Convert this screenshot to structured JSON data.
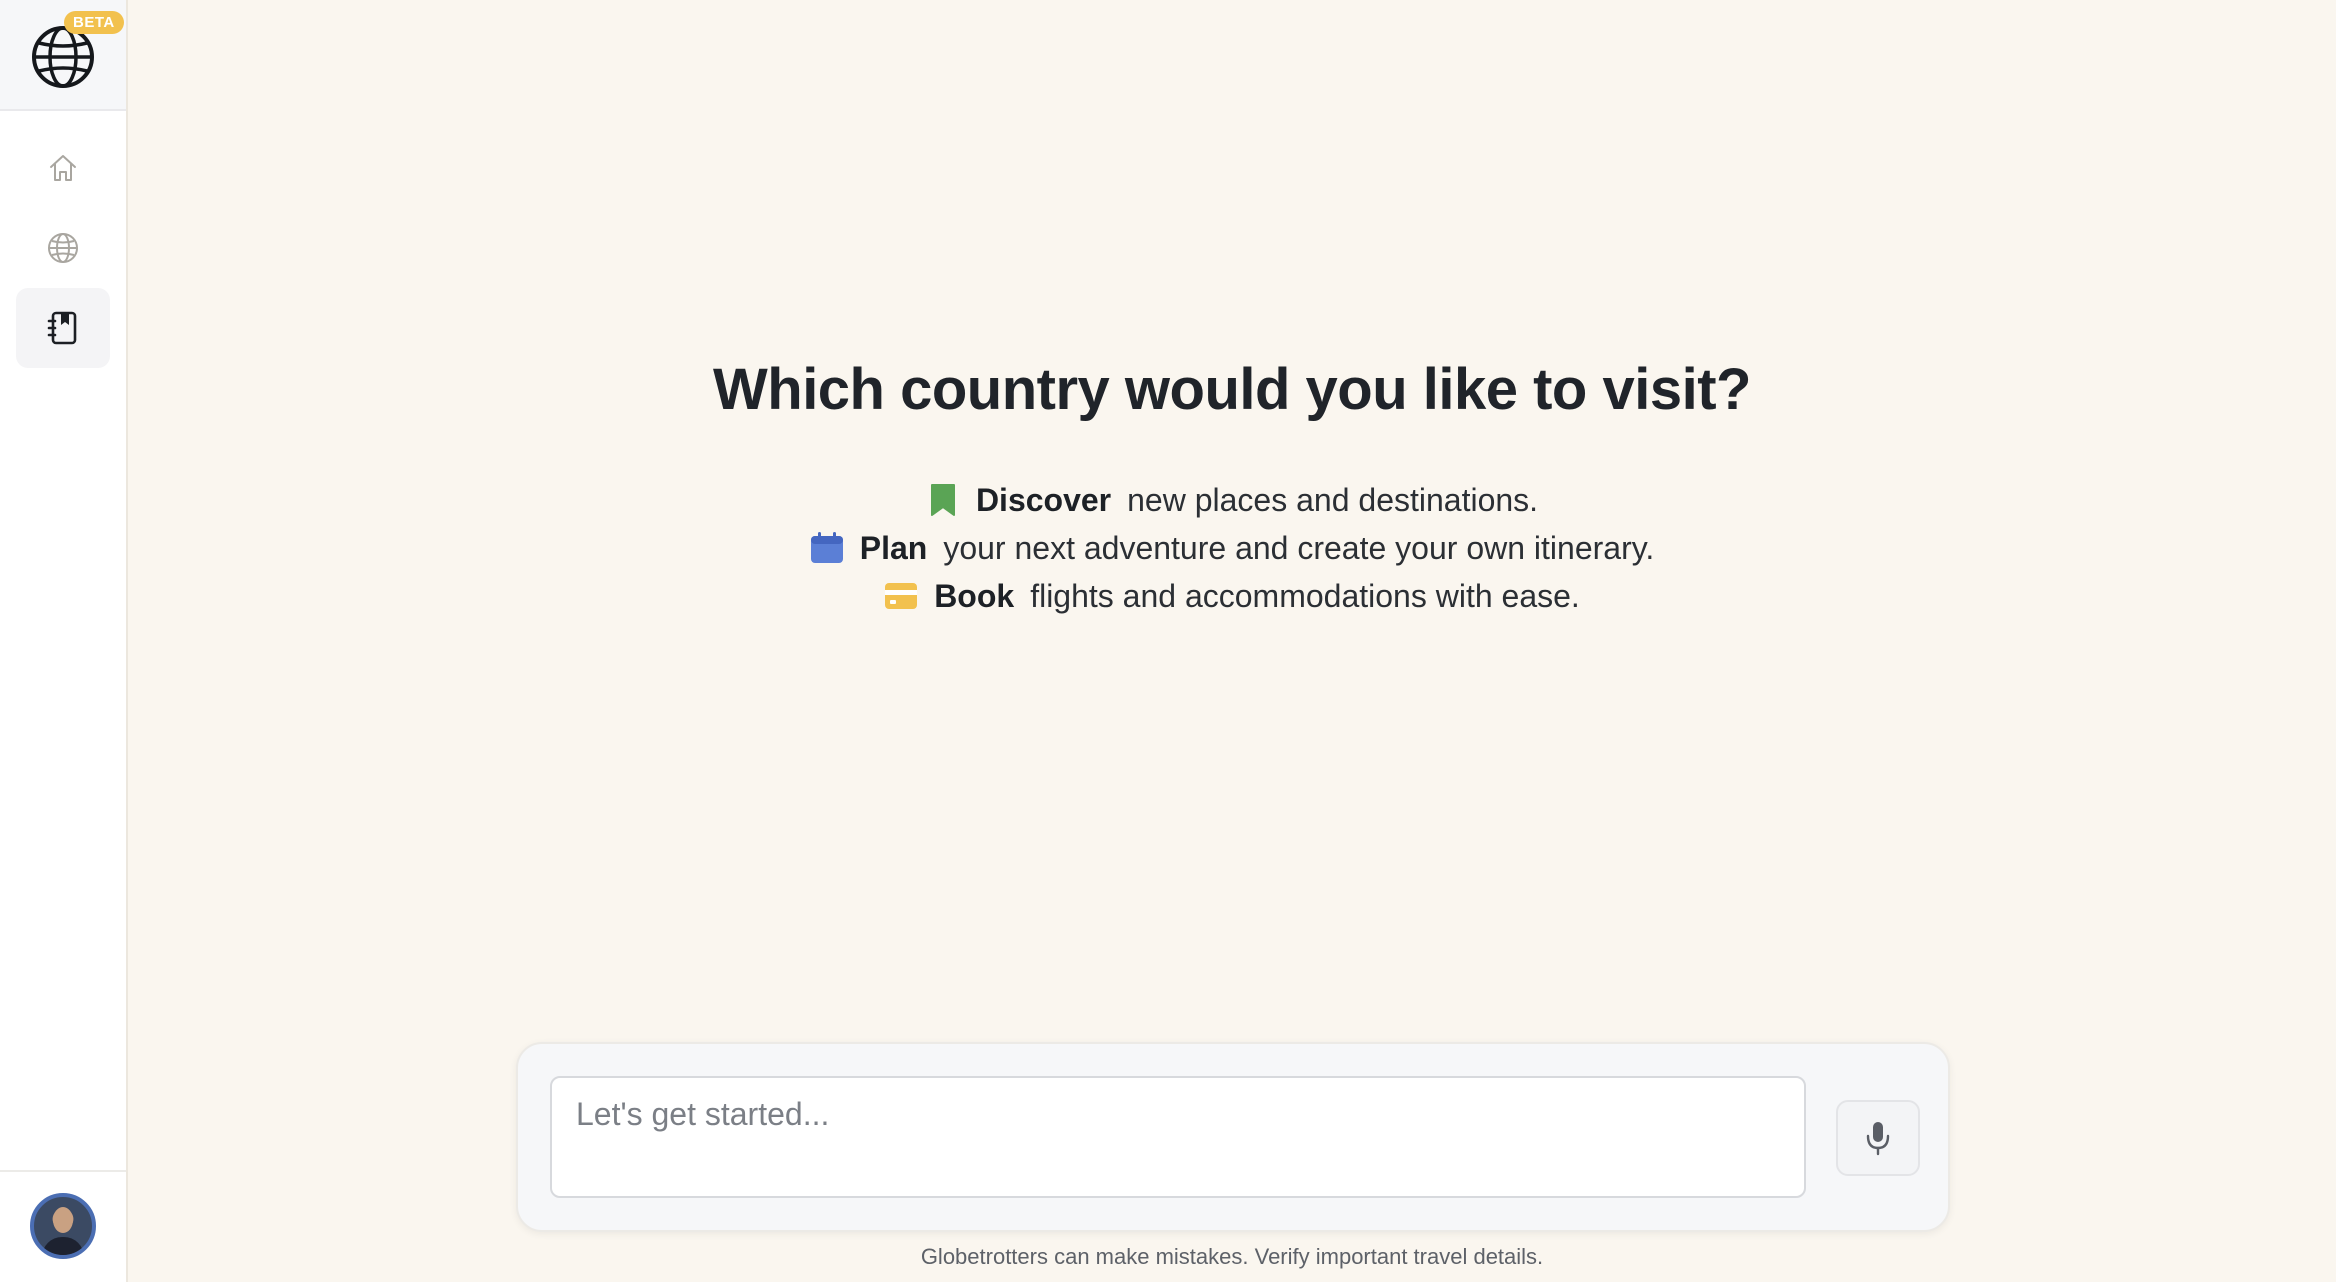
{
  "sidebar": {
    "badge": "BETA",
    "nav": [
      {
        "name": "home",
        "icon": "home-icon"
      },
      {
        "name": "explore",
        "icon": "globe-icon"
      },
      {
        "name": "journal",
        "icon": "journal-icon",
        "active": true
      }
    ]
  },
  "main": {
    "headline": "Which country would you like to visit?",
    "features": [
      {
        "icon": "bookmark-icon",
        "color": "#5aa455",
        "word": "Discover",
        "text": "new places and destinations."
      },
      {
        "icon": "calendar-icon",
        "color": "#5b7fd6",
        "word": "Plan",
        "text": "your next adventure and create your own itinerary."
      },
      {
        "icon": "credit-card-icon",
        "color": "#f2c14e",
        "word": "Book",
        "text": "flights and accommodations with ease."
      }
    ]
  },
  "composer": {
    "placeholder": "Let's get started...",
    "mic_icon": "microphone-icon"
  },
  "footer": {
    "disclaimer": "Globetrotters can make mistakes. Verify important travel details."
  }
}
